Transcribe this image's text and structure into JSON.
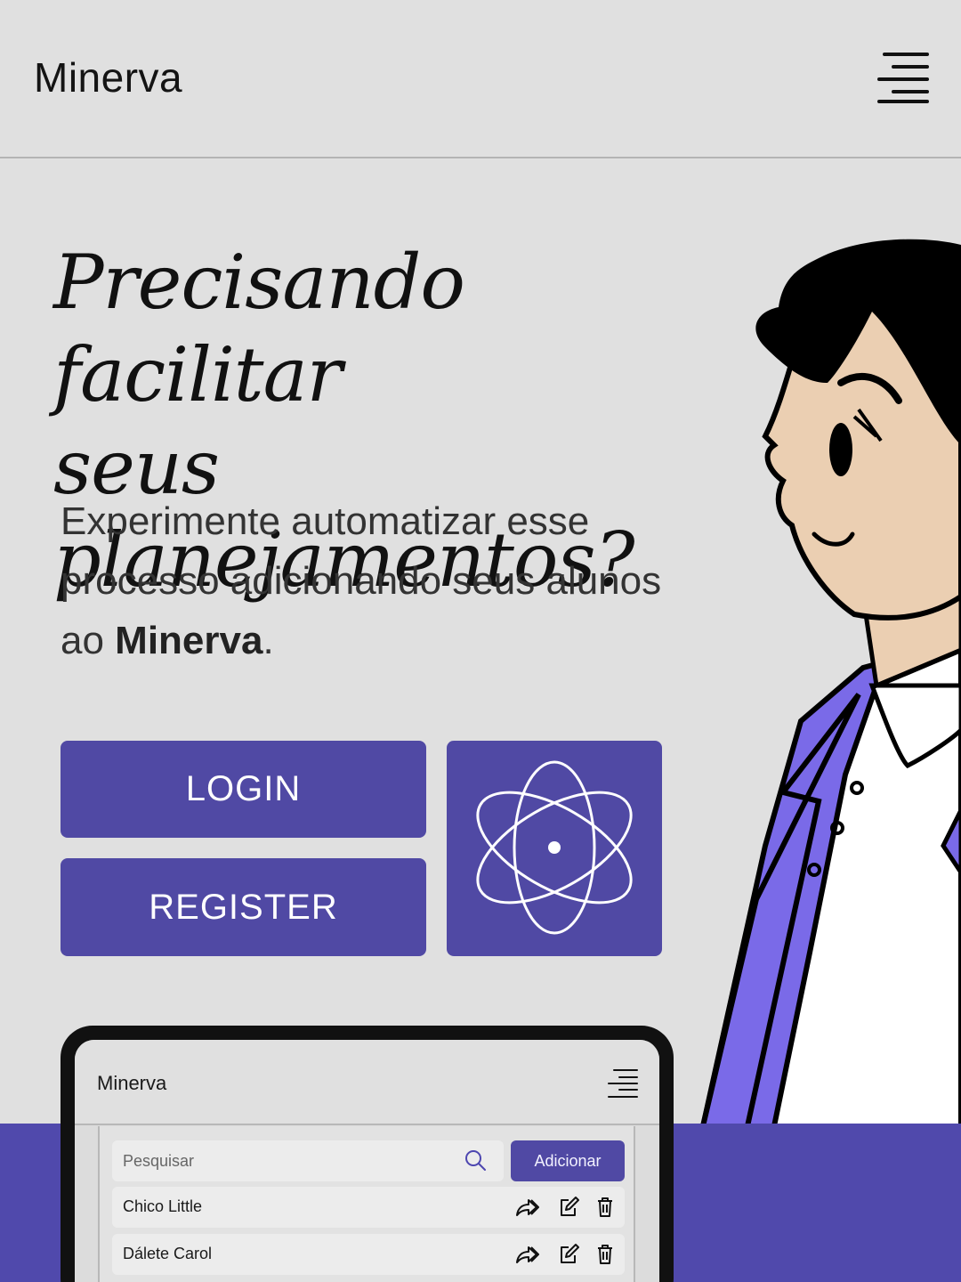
{
  "header": {
    "app_name": "Minerva"
  },
  "hero": {
    "title_line1": "Precisando facilitar",
    "title_line2": "seus planejamentos?",
    "desc_part1": "Experimente automatizar esse processo adicionando seus alunos ao ",
    "desc_brand": "Minerva",
    "desc_end": "."
  },
  "actions": {
    "login_label": "LOGIN",
    "register_label": "REGISTER",
    "atom_icon": "atom-icon"
  },
  "preview": {
    "app_name": "Minerva",
    "search_placeholder": "Pesquisar",
    "add_label": "Adicionar",
    "students": [
      {
        "name": "Chico Little"
      },
      {
        "name": "Dálete Carol"
      }
    ]
  },
  "colors": {
    "primary": "#5049a4",
    "background": "#e0e0e0",
    "skin": "#ebcfb2",
    "jacket": "#7a6ae8"
  }
}
